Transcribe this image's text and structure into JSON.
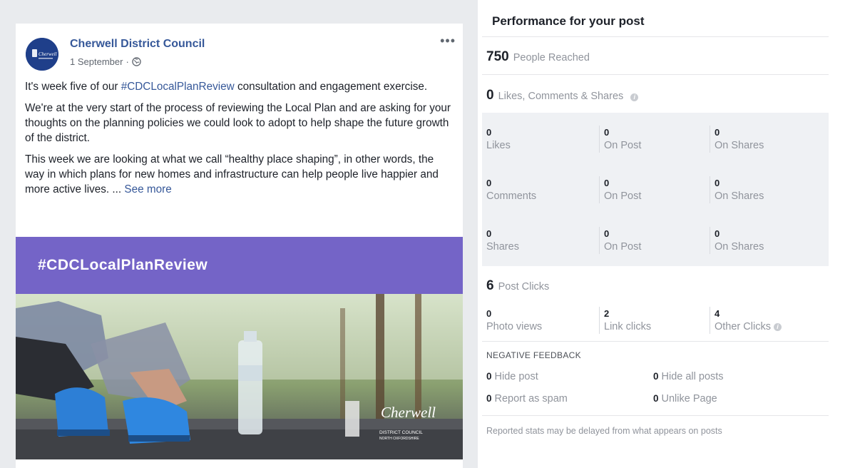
{
  "post": {
    "page_name": "Cherwell District Council",
    "date": "1 September",
    "separator": "·",
    "more": "•••",
    "avatar_text": "Cherwell",
    "paragraph1_before": "It's week five of our ",
    "paragraph1_hashtag": "#CDCLocalPlanReview",
    "paragraph1_after": " consultation and engagement exercise.",
    "paragraph2": "We're at the very start of the process of reviewing the Local Plan and are asking for your thoughts on the planning policies we could look to adopt to help shape the future growth of the district.",
    "paragraph3": "This week we are looking at what we call “healthy place shaping”, in other words, the way in which plans for new homes and infrastructure can help people live happier and more active lives. ... ",
    "see_more": "See more",
    "banner_text": "#CDCLocalPlanReview",
    "logo_text": "Cherwell",
    "logo_sub1": "DISTRICT COUNCIL",
    "logo_sub2": "NORTH OXFORDSHIRE"
  },
  "panel": {
    "title": "Performance for your post",
    "reached": {
      "value": "750",
      "label": "People Reached"
    },
    "engagement": {
      "value": "0",
      "label": "Likes, Comments & Shares"
    },
    "likes": {
      "value": "0",
      "label": "Likes"
    },
    "likes_on_post": {
      "value": "0",
      "label": "On Post"
    },
    "likes_on_shares": {
      "value": "0",
      "label": "On Shares"
    },
    "comments": {
      "value": "0",
      "label": "Comments"
    },
    "comments_on_post": {
      "value": "0",
      "label": "On Post"
    },
    "comments_on_shares": {
      "value": "0",
      "label": "On Shares"
    },
    "shares": {
      "value": "0",
      "label": "Shares"
    },
    "shares_on_post": {
      "value": "0",
      "label": "On Post"
    },
    "shares_on_shares": {
      "value": "0",
      "label": "On Shares"
    },
    "post_clicks": {
      "value": "6",
      "label": "Post Clicks"
    },
    "photo_views": {
      "value": "0",
      "label": "Photo views"
    },
    "link_clicks": {
      "value": "2",
      "label": "Link clicks"
    },
    "other_clicks": {
      "value": "4",
      "label": "Other Clicks"
    },
    "negative_heading": "NEGATIVE FEEDBACK",
    "hide_post": {
      "value": "0",
      "label": "Hide post"
    },
    "hide_all_posts": {
      "value": "0",
      "label": "Hide all posts"
    },
    "report_spam": {
      "value": "0",
      "label": "Report as spam"
    },
    "unlike_page": {
      "value": "0",
      "label": "Unlike Page"
    },
    "footnote": "Reported stats may be delayed from what appears on posts",
    "info_glyph": "i"
  },
  "colors": {
    "link": "#365899",
    "banner": "#7464c7",
    "muted": "#90949c",
    "shaded": "#eff1f4"
  }
}
